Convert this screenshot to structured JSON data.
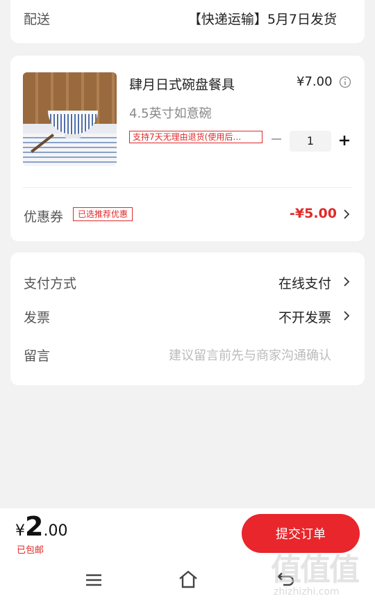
{
  "delivery": {
    "label": "配送",
    "value": "【快递运输】5月7日发货"
  },
  "product": {
    "title": "肆月日式碗盘餐具",
    "price": "¥7.00",
    "spec": "4.5英寸如意碗",
    "return_tag": "支持7天无理由退货(使用后…",
    "quantity": "1"
  },
  "coupon": {
    "label": "优惠券",
    "badge": "已选推荐优惠",
    "amount": "-¥5.00"
  },
  "payment": {
    "label": "支付方式",
    "value": "在线支付"
  },
  "invoice": {
    "label": "发票",
    "value": "不开发票"
  },
  "message": {
    "label": "留言",
    "placeholder": "建议留言前先与商家沟通确认"
  },
  "footer": {
    "currency": "¥",
    "price_int": "2",
    "price_dec": ".00",
    "shipping_note": "已包邮",
    "submit_label": "提交订单"
  },
  "watermark": {
    "text": "值值值",
    "url": "zhizhizhi.com"
  },
  "colors": {
    "accent": "#e8262b",
    "background": "#f2f2f2"
  }
}
